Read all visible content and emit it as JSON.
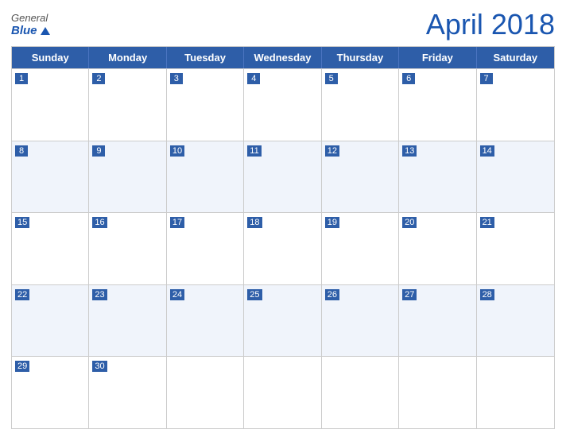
{
  "header": {
    "logo": {
      "general": "General",
      "blue": "Blue"
    },
    "title": "April 2018"
  },
  "days": {
    "headers": [
      "Sunday",
      "Monday",
      "Tuesday",
      "Wednesday",
      "Thursday",
      "Friday",
      "Saturday"
    ]
  },
  "weeks": [
    [
      {
        "num": "1",
        "empty": false
      },
      {
        "num": "2",
        "empty": false
      },
      {
        "num": "3",
        "empty": false
      },
      {
        "num": "4",
        "empty": false
      },
      {
        "num": "5",
        "empty": false
      },
      {
        "num": "6",
        "empty": false
      },
      {
        "num": "7",
        "empty": false
      }
    ],
    [
      {
        "num": "8",
        "empty": false
      },
      {
        "num": "9",
        "empty": false
      },
      {
        "num": "10",
        "empty": false
      },
      {
        "num": "11",
        "empty": false
      },
      {
        "num": "12",
        "empty": false
      },
      {
        "num": "13",
        "empty": false
      },
      {
        "num": "14",
        "empty": false
      }
    ],
    [
      {
        "num": "15",
        "empty": false
      },
      {
        "num": "16",
        "empty": false
      },
      {
        "num": "17",
        "empty": false
      },
      {
        "num": "18",
        "empty": false
      },
      {
        "num": "19",
        "empty": false
      },
      {
        "num": "20",
        "empty": false
      },
      {
        "num": "21",
        "empty": false
      }
    ],
    [
      {
        "num": "22",
        "empty": false
      },
      {
        "num": "23",
        "empty": false
      },
      {
        "num": "24",
        "empty": false
      },
      {
        "num": "25",
        "empty": false
      },
      {
        "num": "26",
        "empty": false
      },
      {
        "num": "27",
        "empty": false
      },
      {
        "num": "28",
        "empty": false
      }
    ],
    [
      {
        "num": "29",
        "empty": false
      },
      {
        "num": "30",
        "empty": false
      },
      {
        "num": "",
        "empty": true
      },
      {
        "num": "",
        "empty": true
      },
      {
        "num": "",
        "empty": true
      },
      {
        "num": "",
        "empty": true
      },
      {
        "num": "",
        "empty": true
      }
    ]
  ]
}
